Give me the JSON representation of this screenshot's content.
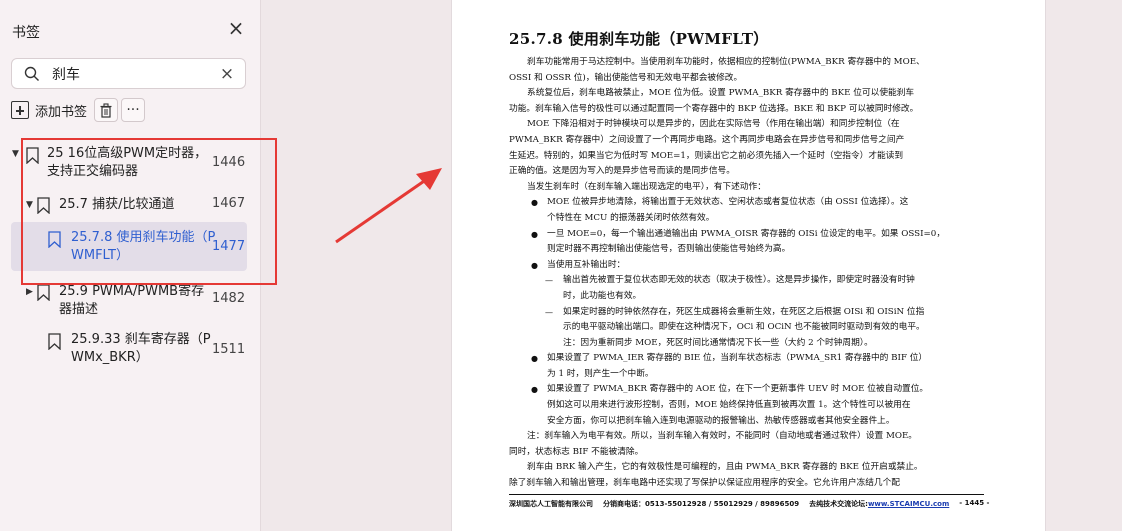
{
  "sidebar": {
    "title": "书签",
    "close_label": "×",
    "search": {
      "value": "刹车",
      "placeholder": ""
    },
    "clear_label": "×",
    "toolbar": {
      "add_label": "添加书签",
      "more_label": "···"
    },
    "tree": [
      {
        "label_1": "25 16位高级PWM定时器，",
        "label_2": "支持正交编码器",
        "page": "1446"
      },
      {
        "label_1": "25.7 捕获/比较通道",
        "page": "1467"
      },
      {
        "label_1": "25.7.8 使用刹车功能（P",
        "label_2": "WMFLT）",
        "page": "1477",
        "selected": true
      },
      {
        "label_1": "25.9 PWMA/PWMB寄存",
        "label_2": "器描述",
        "page": "1482"
      },
      {
        "label_1": "25.9.33 刹车寄存器（P",
        "label_2": "WMx_BKR）",
        "page": "1511"
      }
    ]
  },
  "annotation": {
    "box_color": "#e53935"
  },
  "document": {
    "heading": "25.7.8    使用刹车功能（PWMFLT）",
    "lines": [
      {
        "cls": "ind",
        "text": "刹车功能常用于马达控制中。当使用刹车功能时，依据相应的控制位(PWMA_BKR 寄存器中的 MOE、"
      },
      {
        "cls": "",
        "text": "OSSI 和 OSSR 位)，输出使能信号和无效电平都会被修改。"
      },
      {
        "cls": "ind",
        "text": "系统复位后，刹车电路被禁止，MOE 位为低。设置 PWMA_BKR 寄存器中的 BKE 位可以使能刹车"
      },
      {
        "cls": "",
        "text": "功能。刹车输入信号的极性可以通过配置同一个寄存器中的 BKP 位选择。BKE 和 BKP 可以被同时修改。"
      },
      {
        "cls": "ind",
        "text": "MOE 下降沿相对于时钟模块可以是异步的，因此在实际信号（作用在输出端）和同步控制位（在"
      },
      {
        "cls": "",
        "text": "PWMA_BKR 寄存器中）之间设置了一个再同步电路。这个再同步电路会在异步信号和同步信号之间产"
      },
      {
        "cls": "",
        "text": "生延迟。特别的，如果当它为低时写 MOE=1，则读出它之前必须先插入一个延时（空指令）才能读到"
      },
      {
        "cls": "",
        "text": "正确的值。这是因为写入的是异步信号而读的是同步信号。"
      },
      {
        "cls": "ind",
        "text": "当发生刹车时（在刹车输入端出现选定的电平），有下述动作："
      },
      {
        "cls": "bul",
        "text": "MOE 位被异步地清除，将输出置于无效状态、空闲状态或者复位状态（由 OSSI 位选择）。这"
      },
      {
        "cls": "bulc",
        "text": "个特性在 MCU 的振荡器关闭时依然有效。"
      },
      {
        "cls": "bul",
        "text": "一旦 MOE=0，每一个输出通道输出由 PWMA_OISR 寄存器的 OISi 位设定的电平。如果 OSSI=0，"
      },
      {
        "cls": "bulc",
        "text": "则定时器不再控制输出使能信号，否则输出使能信号始终为高。"
      },
      {
        "cls": "bul",
        "text": "当使用互补输出时："
      },
      {
        "cls": "dash",
        "text": "输出首先被置于复位状态即无效的状态（取决于极性）。这是异步操作，即使定时器没有时钟"
      },
      {
        "cls": "dashc",
        "text": "时，此功能也有效。"
      },
      {
        "cls": "dash",
        "text": "如果定时器的时钟依然存在，死区生成器将会重新生效，在死区之后根据 OISi 和 OISiN 位指"
      },
      {
        "cls": "dashc",
        "text": "示的电平驱动输出端口。即使在这种情况下，OCi 和 OCiN 也不能被同时驱动到有效的电平。"
      },
      {
        "cls": "dashc",
        "text": "注：因为重新同步 MOE，死区时间比通常情况下长一些（大约 2 个时钟周期）。"
      },
      {
        "cls": "bul",
        "text": "如果设置了 PWMA_IER 寄存器的 BIE 位，当刹车状态标志（PWMA_SR1 寄存器中的 BIF 位）"
      },
      {
        "cls": "bulc",
        "text": "为 1 时，则产生一个中断。"
      },
      {
        "cls": "bul",
        "text": "如果设置了 PWMA_BKR 寄存器中的 AOE 位，在下一个更新事件 UEV 时 MOE 位被自动置位。"
      },
      {
        "cls": "bulc",
        "text": "例如这可以用来进行波形控制，否则，MOE 始终保持低直到被再次置 1。这个特性可以被用在"
      },
      {
        "cls": "bulc",
        "text": "安全方面，你可以把刹车输入连到电源驱动的报警输出、热敏传感器或者其他安全器件上。"
      },
      {
        "cls": "ind",
        "text": "注：刹车输入为电平有效。所以，当刹车输入有效时，不能同时（自动地或者通过软件）设置 MOE。"
      },
      {
        "cls": "",
        "text": "同时，状态标志 BIF 不能被清除。"
      },
      {
        "cls": "ind",
        "text": "刹车由 BRK 输入产生，它的有效极性是可编程的，且由 PWMA_BKR 寄存器的 BKE 位开启或禁止。"
      },
      {
        "cls": "",
        "text": "除了刹车输入和输出管理，刹车电路中还实现了写保护以保证应用程序的安全。它允许用户冻结几个配"
      }
    ],
    "footer": {
      "company": "深圳国芯人工智能有限公司",
      "phone": "分销商电话：0513-55012928 / 55012929 / 89896509",
      "forum_label": "去纯技术交流论坛:",
      "forum_link": "www.STCAIMCU.com",
      "page_no": "- 1445 -"
    }
  }
}
